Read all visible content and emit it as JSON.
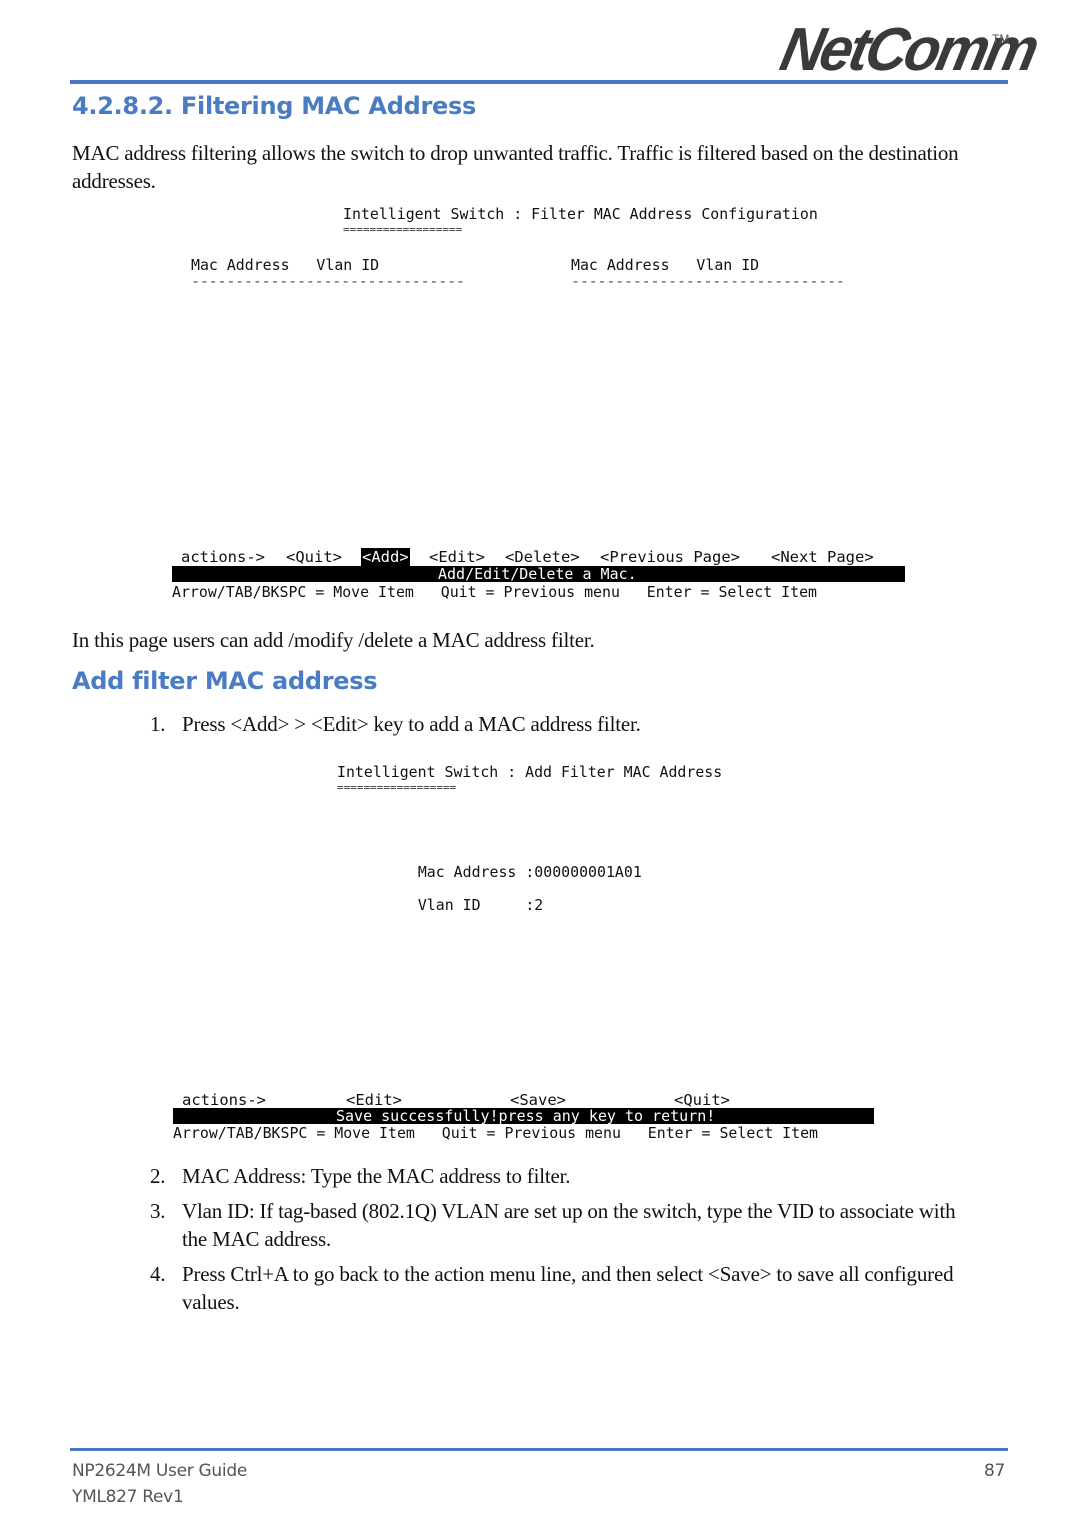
{
  "header": {
    "logo_text": "NetComm",
    "logo_tm": "TM",
    "rule_color": "#4a78c0"
  },
  "section": {
    "heading": "4.2.8.2. Filtering MAC Address",
    "intro": "MAC address filtering allows the switch to drop unwanted traffic.  Traffic is filtered based on the destination addresses.",
    "after_screen": "In this page users can add /modify /delete a MAC address filter."
  },
  "screen1": {
    "title": "Intelligent Switch : Filter MAC Address Configuration",
    "title_underline": "==================",
    "columns_left": "Mac Address   Vlan ID",
    "columns_right": "Mac Address   Vlan ID",
    "dashes_left": "-------------------------------",
    "dashes_right": "-------------------------------",
    "actions": [
      {
        "label": "actions->",
        "selected": false
      },
      {
        "label": "<Quit>",
        "selected": false
      },
      {
        "label": "<Add>",
        "selected": true
      },
      {
        "label": "<Edit>",
        "selected": false
      },
      {
        "label": "<Delete>",
        "selected": false
      },
      {
        "label": "<Previous Page>",
        "selected": false
      },
      {
        "label": "<Next Page>",
        "selected": false
      }
    ],
    "status": "Add/Edit/Delete a Mac.",
    "help": "Arrow/TAB/BKSPC = Move Item   Quit = Previous menu   Enter = Select Item"
  },
  "subsection": {
    "heading": "Add filter MAC address",
    "steps": [
      {
        "num": "1.",
        "text": "Press <Add> > <Edit> key to add a MAC address filter."
      },
      {
        "num": "2.",
        "text": "MAC Address: Type the MAC address to filter."
      },
      {
        "num": "3.",
        "text": "Vlan ID: If tag-based (802.1Q) VLAN are set up on the switch, type the VID to associate with the MAC address."
      },
      {
        "num": "4.",
        "text": "Press Ctrl+A to go back to the action menu line, and then select <Save> to save all configured values."
      }
    ]
  },
  "screen2": {
    "title": "Intelligent Switch : Add Filter MAC Address",
    "title_underline": "==================",
    "mac_label": "Mac Address :",
    "mac_value": "000000001A01",
    "vlan_label": "Vlan ID     :",
    "vlan_value": "2",
    "actions": [
      {
        "label": "actions->"
      },
      {
        "label": "<Edit>"
      },
      {
        "label": "<Save>"
      },
      {
        "label": "<Quit>"
      }
    ],
    "status": "Save successfully!press any key to return!",
    "help": "Arrow/TAB/BKSPC = Move Item   Quit = Previous menu   Enter = Select Item"
  },
  "footer": {
    "guide": "NP2624M User Guide",
    "revision": "YML827 Rev1",
    "page_number": "87"
  }
}
